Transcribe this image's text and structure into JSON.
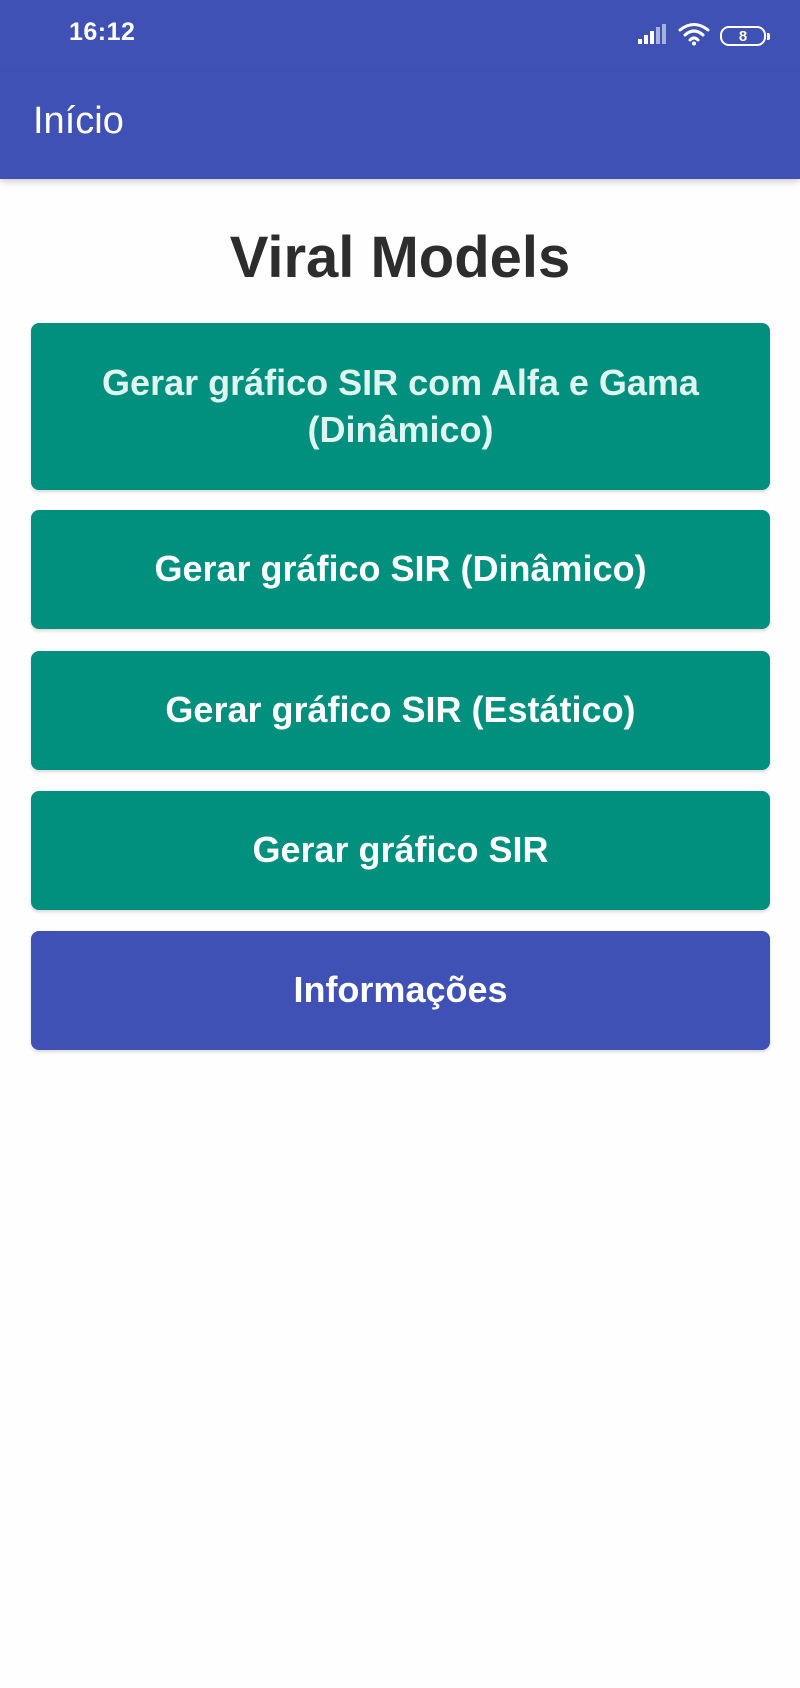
{
  "status_bar": {
    "time": "16:12",
    "battery_level": "8",
    "icons": [
      "signal-icon",
      "wifi-icon",
      "battery-icon"
    ]
  },
  "app_bar": {
    "title": "Início"
  },
  "main": {
    "heading": "Viral Models",
    "buttons": [
      {
        "label": "Gerar gráfico SIR com Alfa e Gama (Dinâmico)",
        "color": "#018f7e"
      },
      {
        "label": "Gerar gráfico SIR (Dinâmico)",
        "color": "#018f7e"
      },
      {
        "label": "Gerar gráfico SIR (Estático)",
        "color": "#018f7e"
      },
      {
        "label": "Gerar gráfico SIR",
        "color": "#018f7e"
      },
      {
        "label": "Informações",
        "color": "#3f51b5"
      }
    ]
  },
  "colors": {
    "primary": "#3f51b5",
    "accent_teal": "#018f7e",
    "background": "#fefefe",
    "heading_text": "#2d2d2d"
  }
}
